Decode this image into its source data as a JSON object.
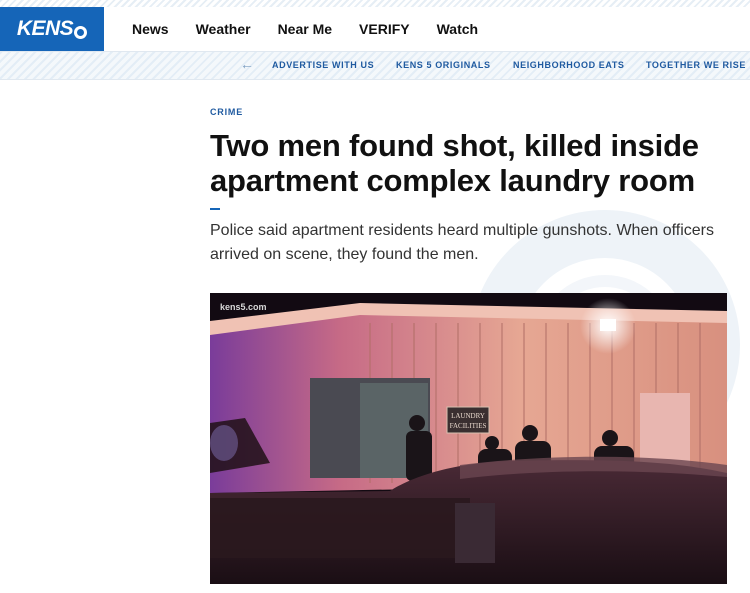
{
  "header": {
    "logo_text": "KENS",
    "nav": [
      "News",
      "Weather",
      "Near Me",
      "VERIFY",
      "Watch"
    ]
  },
  "subnav": {
    "items": [
      "ADVERTISE WITH US",
      "KENS 5 ORIGINALS",
      "NEIGHBORHOOD EATS",
      "TOGETHER WE RISE"
    ]
  },
  "article": {
    "section": "CRIME",
    "headline": "Two men found shot, killed inside apartment complex laundry room",
    "summary": "Police said apartment residents heard multiple gunshots. When officers arrived on scene, they found the men.",
    "photo": {
      "watermark": "kens5.com",
      "sign_line1": "LAUNDRY",
      "sign_line2": "FACILITIES"
    }
  },
  "colors": {
    "brand": "#1565b8",
    "link": "#1f5aa0",
    "headline": "#111111"
  },
  "icons": {
    "back": "arrow-left-icon",
    "logo_mark": "kens5-logo-icon"
  }
}
